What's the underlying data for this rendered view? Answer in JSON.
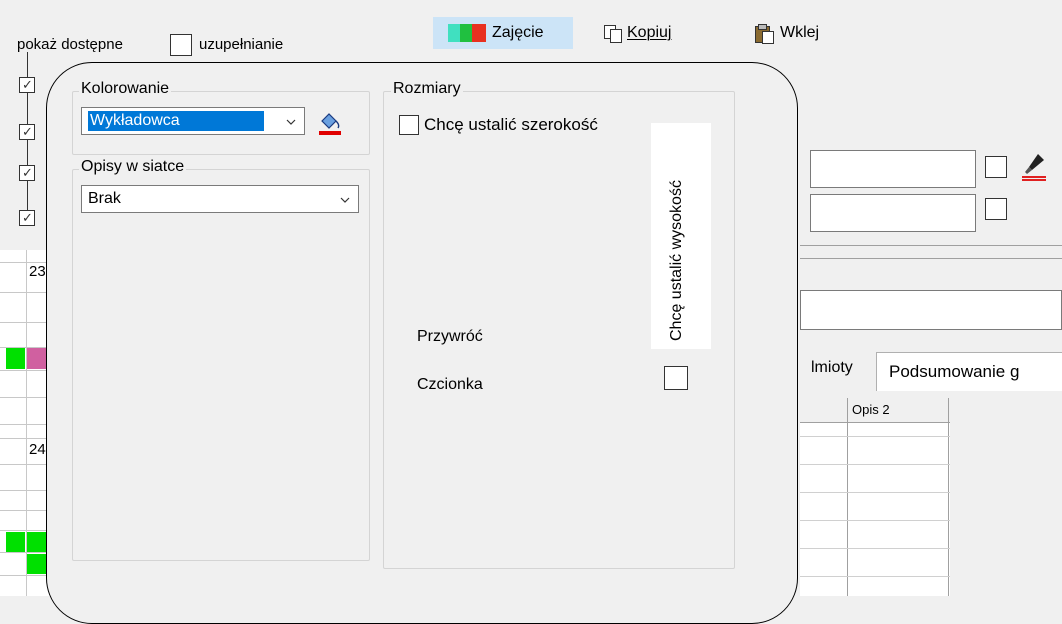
{
  "toolbar": {
    "show_available_label": "pokaż dostępne",
    "fill_label": "uzupełnianie",
    "class_button_label": "Zajęcie",
    "copy_button_label": "Kopiuj",
    "paste_button_label": "Wklej"
  },
  "panel": {
    "coloring_legend": "Kolorowanie",
    "coloring_value": "Wykładowca",
    "grid_desc_legend": "Opisy w siatce",
    "grid_desc_value": "Brak",
    "size_legend": "Rozmiary",
    "set_width_label": "Chcę ustalić szerokość",
    "set_height_label": "Chcę ustalić wysokość",
    "restore_label": "Przywróć",
    "font_label": "Czcionka"
  },
  "background": {
    "row_number_1": "23.",
    "row_number_2": "24.",
    "tab_subjects": "lmioty",
    "tab_summary": "Podsumowanie g",
    "column_opis2": "Opis 2"
  },
  "colors": {
    "green": "#00e000",
    "pink": "#d060a0",
    "highlight": "#0078d7",
    "toolbar_active": "#cce4f7"
  }
}
